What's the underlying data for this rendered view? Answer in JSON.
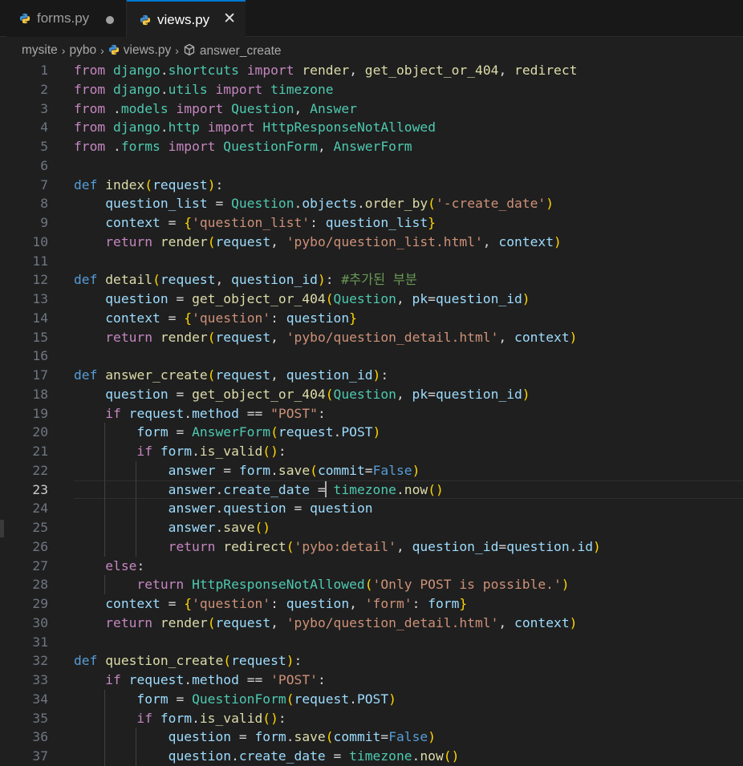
{
  "tabs": [
    {
      "label": "forms.py",
      "active": false,
      "modified": true
    },
    {
      "label": "views.py",
      "active": true,
      "close_glyph": "✕"
    }
  ],
  "breadcrumb": {
    "items": [
      "mysite",
      "pybo",
      "views.py",
      "answer_create"
    ],
    "separator": "›"
  },
  "editor": {
    "current_line": 23,
    "lines": [
      [
        [
          "k",
          "from"
        ],
        [
          "o",
          " "
        ],
        [
          "c",
          "django"
        ],
        [
          "o",
          "."
        ],
        [
          "c",
          "shortcuts"
        ],
        [
          "o",
          " "
        ],
        [
          "k",
          "import"
        ],
        [
          "o",
          " "
        ],
        [
          "f",
          "render"
        ],
        [
          "o",
          ", "
        ],
        [
          "f",
          "get_object_or_404"
        ],
        [
          "o",
          ", "
        ],
        [
          "f",
          "redirect"
        ]
      ],
      [
        [
          "k",
          "from"
        ],
        [
          "o",
          " "
        ],
        [
          "c",
          "django"
        ],
        [
          "o",
          "."
        ],
        [
          "c",
          "utils"
        ],
        [
          "o",
          " "
        ],
        [
          "k",
          "import"
        ],
        [
          "o",
          " "
        ],
        [
          "c",
          "timezone"
        ]
      ],
      [
        [
          "k",
          "from"
        ],
        [
          "o",
          " ."
        ],
        [
          "c",
          "models"
        ],
        [
          "o",
          " "
        ],
        [
          "k",
          "import"
        ],
        [
          "o",
          " "
        ],
        [
          "c",
          "Question"
        ],
        [
          "o",
          ", "
        ],
        [
          "c",
          "Answer"
        ]
      ],
      [
        [
          "k",
          "from"
        ],
        [
          "o",
          " "
        ],
        [
          "c",
          "django"
        ],
        [
          "o",
          "."
        ],
        [
          "c",
          "http"
        ],
        [
          "o",
          " "
        ],
        [
          "k",
          "import"
        ],
        [
          "o",
          " "
        ],
        [
          "c",
          "HttpResponseNotAllowed"
        ]
      ],
      [
        [
          "k",
          "from"
        ],
        [
          "o",
          " ."
        ],
        [
          "c",
          "forms"
        ],
        [
          "o",
          " "
        ],
        [
          "k",
          "import"
        ],
        [
          "o",
          " "
        ],
        [
          "c",
          "QuestionForm"
        ],
        [
          "o",
          ", "
        ],
        [
          "c",
          "AnswerForm"
        ]
      ],
      [],
      [
        [
          "d",
          "def"
        ],
        [
          "o",
          " "
        ],
        [
          "f",
          "index"
        ],
        [
          "p1",
          "("
        ],
        [
          "v",
          "request"
        ],
        [
          "p1",
          ")"
        ],
        [
          "o",
          ":"
        ]
      ],
      [
        [
          "o",
          "    "
        ],
        [
          "v",
          "question_list"
        ],
        [
          "o",
          " = "
        ],
        [
          "c",
          "Question"
        ],
        [
          "o",
          "."
        ],
        [
          "v",
          "objects"
        ],
        [
          "o",
          "."
        ],
        [
          "f",
          "order_by"
        ],
        [
          "p1",
          "("
        ],
        [
          "s",
          "'-create_date'"
        ],
        [
          "p1",
          ")"
        ]
      ],
      [
        [
          "o",
          "    "
        ],
        [
          "v",
          "context"
        ],
        [
          "o",
          " = "
        ],
        [
          "p1",
          "{"
        ],
        [
          "s",
          "'question_list'"
        ],
        [
          "o",
          ": "
        ],
        [
          "v",
          "question_list"
        ],
        [
          "p1",
          "}"
        ]
      ],
      [
        [
          "o",
          "    "
        ],
        [
          "k",
          "return"
        ],
        [
          "o",
          " "
        ],
        [
          "f",
          "render"
        ],
        [
          "p1",
          "("
        ],
        [
          "v",
          "request"
        ],
        [
          "o",
          ", "
        ],
        [
          "s",
          "'pybo/question_list.html'"
        ],
        [
          "o",
          ", "
        ],
        [
          "v",
          "context"
        ],
        [
          "p1",
          ")"
        ]
      ],
      [],
      [
        [
          "d",
          "def"
        ],
        [
          "o",
          " "
        ],
        [
          "f",
          "detail"
        ],
        [
          "p1",
          "("
        ],
        [
          "v",
          "request"
        ],
        [
          "o",
          ", "
        ],
        [
          "v",
          "question_id"
        ],
        [
          "p1",
          ")"
        ],
        [
          "o",
          ": "
        ],
        [
          "m",
          "#추가된 부분"
        ]
      ],
      [
        [
          "o",
          "    "
        ],
        [
          "v",
          "question"
        ],
        [
          "o",
          " = "
        ],
        [
          "f",
          "get_object_or_404"
        ],
        [
          "p1",
          "("
        ],
        [
          "c",
          "Question"
        ],
        [
          "o",
          ", "
        ],
        [
          "v",
          "pk"
        ],
        [
          "o",
          "="
        ],
        [
          "v",
          "question_id"
        ],
        [
          "p1",
          ")"
        ]
      ],
      [
        [
          "o",
          "    "
        ],
        [
          "v",
          "context"
        ],
        [
          "o",
          " = "
        ],
        [
          "p1",
          "{"
        ],
        [
          "s",
          "'question'"
        ],
        [
          "o",
          ": "
        ],
        [
          "v",
          "question"
        ],
        [
          "p1",
          "}"
        ]
      ],
      [
        [
          "o",
          "    "
        ],
        [
          "k",
          "return"
        ],
        [
          "o",
          " "
        ],
        [
          "f",
          "render"
        ],
        [
          "p1",
          "("
        ],
        [
          "v",
          "request"
        ],
        [
          "o",
          ", "
        ],
        [
          "s",
          "'pybo/question_detail.html'"
        ],
        [
          "o",
          ", "
        ],
        [
          "v",
          "context"
        ],
        [
          "p1",
          ")"
        ]
      ],
      [],
      [
        [
          "d",
          "def"
        ],
        [
          "o",
          " "
        ],
        [
          "f",
          "answer_create"
        ],
        [
          "p1",
          "("
        ],
        [
          "v",
          "request"
        ],
        [
          "o",
          ", "
        ],
        [
          "v",
          "question_id"
        ],
        [
          "p1",
          ")"
        ],
        [
          "o",
          ":"
        ]
      ],
      [
        [
          "o",
          "    "
        ],
        [
          "v",
          "question"
        ],
        [
          "o",
          " = "
        ],
        [
          "f",
          "get_object_or_404"
        ],
        [
          "p1",
          "("
        ],
        [
          "c",
          "Question"
        ],
        [
          "o",
          ", "
        ],
        [
          "v",
          "pk"
        ],
        [
          "o",
          "="
        ],
        [
          "v",
          "question_id"
        ],
        [
          "p1",
          ")"
        ]
      ],
      [
        [
          "o",
          "    "
        ],
        [
          "k",
          "if"
        ],
        [
          "o",
          " "
        ],
        [
          "v",
          "request"
        ],
        [
          "o",
          "."
        ],
        [
          "v",
          "method"
        ],
        [
          "o",
          " == "
        ],
        [
          "s",
          "\"POST\""
        ],
        [
          "o",
          ":"
        ]
      ],
      [
        [
          "o",
          "        "
        ],
        [
          "v",
          "form"
        ],
        [
          "o",
          " = "
        ],
        [
          "c",
          "AnswerForm"
        ],
        [
          "p1",
          "("
        ],
        [
          "v",
          "request"
        ],
        [
          "o",
          "."
        ],
        [
          "v",
          "POST"
        ],
        [
          "p1",
          ")"
        ]
      ],
      [
        [
          "o",
          "        "
        ],
        [
          "k",
          "if"
        ],
        [
          "o",
          " "
        ],
        [
          "v",
          "form"
        ],
        [
          "o",
          "."
        ],
        [
          "f",
          "is_valid"
        ],
        [
          "p1",
          "()"
        ],
        [
          "o",
          ":"
        ]
      ],
      [
        [
          "o",
          "            "
        ],
        [
          "v",
          "answer"
        ],
        [
          "o",
          " = "
        ],
        [
          "v",
          "form"
        ],
        [
          "o",
          "."
        ],
        [
          "f",
          "save"
        ],
        [
          "p1",
          "("
        ],
        [
          "v",
          "commit"
        ],
        [
          "o",
          "="
        ],
        [
          "b",
          "False"
        ],
        [
          "p1",
          ")"
        ]
      ],
      [
        [
          "o",
          "            "
        ],
        [
          "v",
          "answer"
        ],
        [
          "o",
          "."
        ],
        [
          "v",
          "create_date"
        ],
        [
          "o",
          " ="
        ],
        [
          "cursor",
          ""
        ],
        [
          "o",
          " "
        ],
        [
          "c",
          "timezone"
        ],
        [
          "o",
          "."
        ],
        [
          "f",
          "now"
        ],
        [
          "p1",
          "()"
        ]
      ],
      [
        [
          "o",
          "            "
        ],
        [
          "v",
          "answer"
        ],
        [
          "o",
          "."
        ],
        [
          "v",
          "question"
        ],
        [
          "o",
          " = "
        ],
        [
          "v",
          "question"
        ]
      ],
      [
        [
          "o",
          "            "
        ],
        [
          "v",
          "answer"
        ],
        [
          "o",
          "."
        ],
        [
          "f",
          "save"
        ],
        [
          "p1",
          "()"
        ]
      ],
      [
        [
          "o",
          "            "
        ],
        [
          "k",
          "return"
        ],
        [
          "o",
          " "
        ],
        [
          "f",
          "redirect"
        ],
        [
          "p1",
          "("
        ],
        [
          "s",
          "'pybo:detail'"
        ],
        [
          "o",
          ", "
        ],
        [
          "v",
          "question_id"
        ],
        [
          "o",
          "="
        ],
        [
          "v",
          "question"
        ],
        [
          "o",
          "."
        ],
        [
          "v",
          "id"
        ],
        [
          "p1",
          ")"
        ]
      ],
      [
        [
          "o",
          "    "
        ],
        [
          "k",
          "else"
        ],
        [
          "o",
          ":"
        ]
      ],
      [
        [
          "o",
          "        "
        ],
        [
          "k",
          "return"
        ],
        [
          "o",
          " "
        ],
        [
          "c",
          "HttpResponseNotAllowed"
        ],
        [
          "p1",
          "("
        ],
        [
          "s",
          "'Only POST is possible.'"
        ],
        [
          "p1",
          ")"
        ]
      ],
      [
        [
          "o",
          "    "
        ],
        [
          "v",
          "context"
        ],
        [
          "o",
          " = "
        ],
        [
          "p1",
          "{"
        ],
        [
          "s",
          "'question'"
        ],
        [
          "o",
          ": "
        ],
        [
          "v",
          "question"
        ],
        [
          "o",
          ", "
        ],
        [
          "s",
          "'form'"
        ],
        [
          "o",
          ": "
        ],
        [
          "v",
          "form"
        ],
        [
          "p1",
          "}"
        ]
      ],
      [
        [
          "o",
          "    "
        ],
        [
          "k",
          "return"
        ],
        [
          "o",
          " "
        ],
        [
          "f",
          "render"
        ],
        [
          "p1",
          "("
        ],
        [
          "v",
          "request"
        ],
        [
          "o",
          ", "
        ],
        [
          "s",
          "'pybo/question_detail.html'"
        ],
        [
          "o",
          ", "
        ],
        [
          "v",
          "context"
        ],
        [
          "p1",
          ")"
        ]
      ],
      [],
      [
        [
          "d",
          "def"
        ],
        [
          "o",
          " "
        ],
        [
          "f",
          "question_create"
        ],
        [
          "p1",
          "("
        ],
        [
          "v",
          "request"
        ],
        [
          "p1",
          ")"
        ],
        [
          "o",
          ":"
        ]
      ],
      [
        [
          "o",
          "    "
        ],
        [
          "k",
          "if"
        ],
        [
          "o",
          " "
        ],
        [
          "v",
          "request"
        ],
        [
          "o",
          "."
        ],
        [
          "v",
          "method"
        ],
        [
          "o",
          " == "
        ],
        [
          "s",
          "'POST'"
        ],
        [
          "o",
          ":"
        ]
      ],
      [
        [
          "o",
          "        "
        ],
        [
          "v",
          "form"
        ],
        [
          "o",
          " = "
        ],
        [
          "c",
          "QuestionForm"
        ],
        [
          "p1",
          "("
        ],
        [
          "v",
          "request"
        ],
        [
          "o",
          "."
        ],
        [
          "v",
          "POST"
        ],
        [
          "p1",
          ")"
        ]
      ],
      [
        [
          "o",
          "        "
        ],
        [
          "k",
          "if"
        ],
        [
          "o",
          " "
        ],
        [
          "v",
          "form"
        ],
        [
          "o",
          "."
        ],
        [
          "f",
          "is_valid"
        ],
        [
          "p1",
          "()"
        ],
        [
          "o",
          ":"
        ]
      ],
      [
        [
          "o",
          "            "
        ],
        [
          "v",
          "question"
        ],
        [
          "o",
          " = "
        ],
        [
          "v",
          "form"
        ],
        [
          "o",
          "."
        ],
        [
          "f",
          "save"
        ],
        [
          "p1",
          "("
        ],
        [
          "v",
          "commit"
        ],
        [
          "o",
          "="
        ],
        [
          "b",
          "False"
        ],
        [
          "p1",
          ")"
        ]
      ],
      [
        [
          "o",
          "            "
        ],
        [
          "v",
          "question"
        ],
        [
          "o",
          "."
        ],
        [
          "v",
          "create_date"
        ],
        [
          "o",
          " = "
        ],
        [
          "c",
          "timezone"
        ],
        [
          "o",
          "."
        ],
        [
          "f",
          "now"
        ],
        [
          "p1",
          "()"
        ]
      ]
    ]
  }
}
